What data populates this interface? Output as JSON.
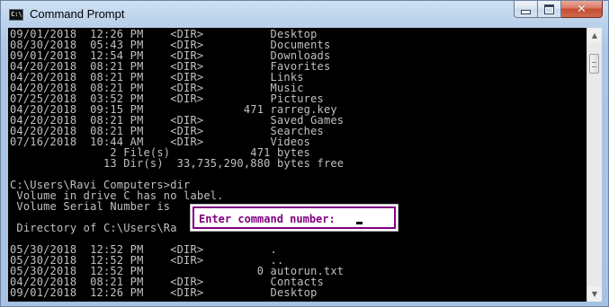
{
  "window": {
    "title": "Command Prompt",
    "icon_label": "C:\\",
    "close_symbol": "✕"
  },
  "console": {
    "lines": [
      "09/01/2018  12:26 PM    <DIR>          Desktop",
      "08/30/2018  05:43 PM    <DIR>          Documents",
      "09/01/2018  12:54 PM    <DIR>          Downloads",
      "04/20/2018  08:21 PM    <DIR>          Favorites",
      "04/20/2018  08:21 PM    <DIR>          Links",
      "04/20/2018  08:21 PM    <DIR>          Music",
      "07/25/2018  03:52 PM    <DIR>          Pictures",
      "04/20/2018  09:15 PM               471 rarreg.key",
      "04/20/2018  08:21 PM    <DIR>          Saved Games",
      "04/20/2018  08:21 PM    <DIR>          Searches",
      "07/16/2018  10:44 AM    <DIR>          Videos",
      "               2 File(s)            471 bytes",
      "              13 Dir(s)  33,735,290,880 bytes free",
      "",
      "C:\\Users\\Ravi Computers>dir",
      " Volume in drive C has no label.",
      " Volume Serial Number is",
      "",
      " Directory of C:\\Users\\Ra",
      "",
      "05/30/2018  12:52 PM    <DIR>          .",
      "05/30/2018  12:52 PM    <DIR>          ..",
      "05/30/2018  12:52 PM                 0 autorun.txt",
      "04/20/2018  08:21 PM    <DIR>          Contacts",
      "09/01/2018  12:26 PM    <DIR>          Desktop"
    ]
  },
  "prompt": {
    "label": "Enter command number: "
  },
  "scrollbar": {
    "up_arrow": "▲",
    "down_arrow": "▼"
  },
  "colors": {
    "console_background": "#000000",
    "console_text": "#c0c0c0",
    "prompt_accent": "#800080"
  }
}
